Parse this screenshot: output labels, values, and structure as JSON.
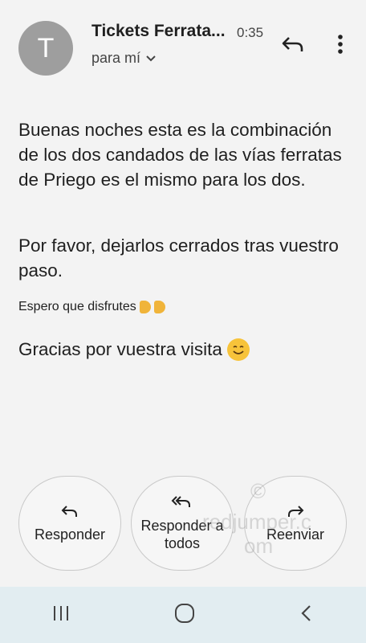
{
  "header": {
    "avatar_letter": "T",
    "sender": "Tickets Ferrata...",
    "time": "0:35",
    "recipient": "para mí"
  },
  "body": {
    "paragraph1": "Buenas noches esta es la combinación de los  dos candados de las vías ferratas de Priego es el mismo para los dos.",
    "paragraph2": "Por favor, dejarlos cerrados tras vuestro paso.",
    "paragraph3": "Espero que disfrutes",
    "paragraph4": "Gracias por vuestra visita"
  },
  "actions": {
    "reply": "Responder",
    "reply_all": "Responder a todos",
    "forward": "Reenviar"
  },
  "watermark": {
    "line1": "©",
    "line2": "redjumper.c",
    "line3": "om"
  },
  "icons": {
    "reply": "reply-icon",
    "more": "more-vert-icon",
    "recents": "recents-icon",
    "home": "home-icon",
    "back": "back-icon"
  }
}
